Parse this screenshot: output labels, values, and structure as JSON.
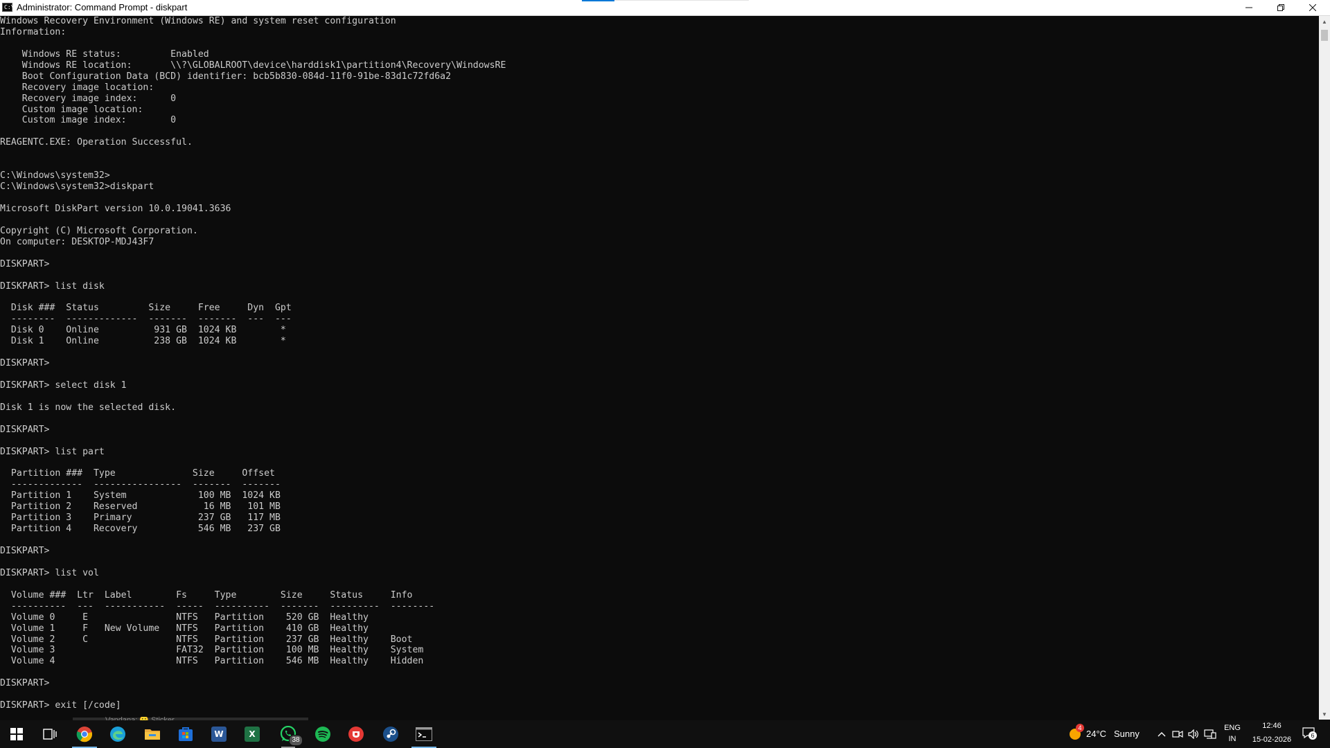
{
  "window": {
    "title": "Administrator: Command Prompt - diskpart",
    "icon_text": "C:\\",
    "controls": [
      "minimize-icon",
      "restore-icon",
      "close-icon"
    ]
  },
  "console": {
    "lines": [
      "Windows Recovery Environment (Windows RE) and system reset configuration",
      "Information:",
      "",
      "    Windows RE status:         Enabled",
      "    Windows RE location:       \\\\?\\GLOBALROOT\\device\\harddisk1\\partition4\\Recovery\\WindowsRE",
      "    Boot Configuration Data (BCD) identifier: bcb5b830-084d-11f0-91be-83d1c72fd6a2",
      "    Recovery image location:",
      "    Recovery image index:      0",
      "    Custom image location:",
      "    Custom image index:        0",
      "",
      "REAGENTC.EXE: Operation Successful.",
      "",
      "",
      "C:\\Windows\\system32>",
      "C:\\Windows\\system32>diskpart",
      "",
      "Microsoft DiskPart version 10.0.19041.3636",
      "",
      "Copyright (C) Microsoft Corporation.",
      "On computer: DESKTOP-MDJ43F7",
      "",
      "DISKPART>",
      "",
      "DISKPART> list disk",
      "",
      "  Disk ###  Status         Size     Free     Dyn  Gpt",
      "  --------  -------------  -------  -------  ---  ---",
      "  Disk 0    Online          931 GB  1024 KB        *",
      "  Disk 1    Online          238 GB  1024 KB        *",
      "",
      "DISKPART>",
      "",
      "DISKPART> select disk 1",
      "",
      "Disk 1 is now the selected disk.",
      "",
      "DISKPART>",
      "",
      "DISKPART> list part",
      "",
      "  Partition ###  Type              Size     Offset",
      "  -------------  ----------------  -------  -------",
      "  Partition 1    System             100 MB  1024 KB",
      "  Partition 2    Reserved            16 MB   101 MB",
      "  Partition 3    Primary            237 GB   117 MB",
      "  Partition 4    Recovery           546 MB   237 GB",
      "",
      "DISKPART>",
      "",
      "DISKPART> list vol",
      "",
      "  Volume ###  Ltr  Label        Fs     Type        Size     Status     Info",
      "  ----------  ---  -----------  -----  ----------  -------  ---------  --------",
      "  Volume 0     E                NTFS   Partition    520 GB  Healthy",
      "  Volume 1     F   New Volume   NTFS   Partition    410 GB  Healthy",
      "  Volume 2     C                NTFS   Partition    237 GB  Healthy    Boot",
      "  Volume 3                      FAT32  Partition    100 MB  Healthy    System",
      "  Volume 4                      NTFS   Partition    546 MB  Healthy    Hidden",
      "",
      "DISKPART>",
      "",
      "DISKPART> exit [/code]"
    ]
  },
  "peek": {
    "text": "Vandana: 🙂 Sticker"
  },
  "taskbar": {
    "items": [
      {
        "name": "start-button",
        "icon": "windows-logo-icon",
        "color": "#ffffff"
      },
      {
        "name": "task-view-button",
        "icon": "task-view-icon",
        "color": "#ffffff"
      },
      {
        "name": "taskbar-chrome",
        "icon": "chrome-icon",
        "color": "#e8453c",
        "state": "active"
      },
      {
        "name": "taskbar-edge",
        "icon": "edge-icon",
        "color": "#1ba0d8"
      },
      {
        "name": "taskbar-file-explorer",
        "icon": "folder-icon",
        "color": "#f6c342"
      },
      {
        "name": "taskbar-microsoft-store",
        "icon": "store-icon",
        "color": "#1e6fd9"
      },
      {
        "name": "taskbar-word",
        "icon": "word-icon",
        "color": "#2b5797",
        "letter": "W"
      },
      {
        "name": "taskbar-excel",
        "icon": "excel-icon",
        "color": "#1f7244",
        "letter": "X"
      },
      {
        "name": "taskbar-whatsapp",
        "icon": "whatsapp-icon",
        "color": "#25d366",
        "badge": "38",
        "state": "open"
      },
      {
        "name": "taskbar-spotify",
        "icon": "spotify-icon",
        "color": "#1db954"
      },
      {
        "name": "taskbar-anydesk",
        "icon": "app-red-icon",
        "color": "#e53935"
      },
      {
        "name": "taskbar-steam",
        "icon": "steam-icon",
        "color": "#1b4f8a"
      },
      {
        "name": "taskbar-command-prompt",
        "icon": "cmd-icon",
        "color": "#0c0c0c",
        "state": "active"
      }
    ],
    "weather": {
      "temp": "24°C",
      "condition": "Sunny",
      "alert": "4"
    },
    "tray": {
      "lang_top": "ENG",
      "lang_bottom": "IN",
      "time": "12:46",
      "date": "15-02-2026",
      "notification_count": "6"
    }
  }
}
